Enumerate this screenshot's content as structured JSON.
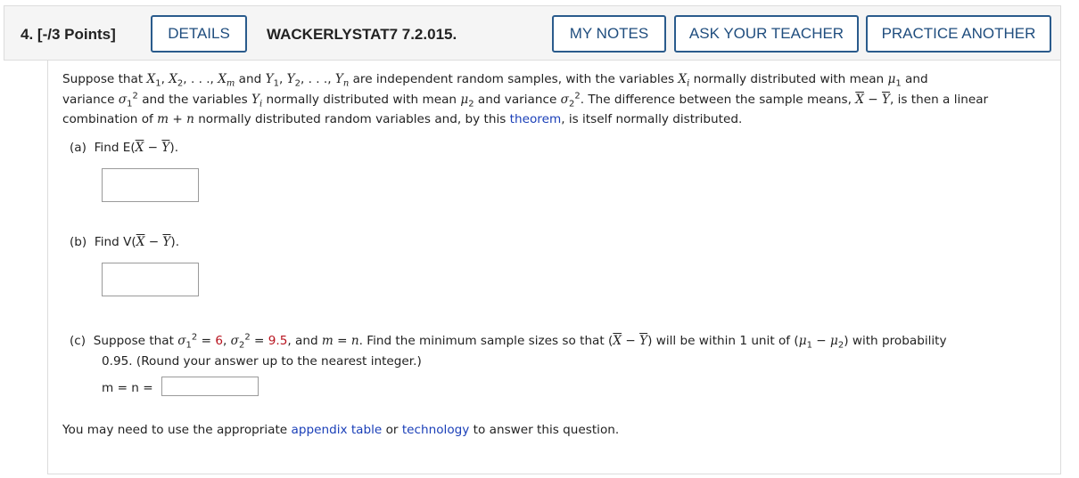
{
  "header": {
    "question_number": "4.",
    "points": "[-/3 Points]",
    "details_label": "DETAILS",
    "assignment_code": "WACKERLYSTAT7 7.2.015.",
    "my_notes_label": "MY NOTES",
    "ask_teacher_label": "ASK YOUR TEACHER",
    "practice_another_label": "PRACTICE ANOTHER"
  },
  "intro": {
    "t1": "Suppose that ",
    "t2": " are independent random samples, with the variables ",
    "t3": " normally distributed with mean ",
    "t4": " and",
    "t5": "variance ",
    "t6": " and the variables ",
    "t7": " normally distributed with mean ",
    "t8": " and variance ",
    "t9": ". The difference between the sample means, ",
    "t10": ", is then a linear",
    "t11": "combination of ",
    "t12": " normally distributed random variables and, by this ",
    "theorem_link": "theorem",
    "t13": ", is itself normally distributed."
  },
  "part_a": {
    "label": "(a)",
    "prompt": "Find E(",
    "close": ").",
    "answer": ""
  },
  "part_b": {
    "label": "(b)",
    "prompt": "Find V(",
    "close": ").",
    "answer": ""
  },
  "part_c": {
    "label": "(c)",
    "t1": "Suppose that ",
    "sigma1_value": "6",
    "sigma2_value": "9.5",
    "t2": ", and ",
    "t3": ". Find the minimum sample sizes so that ",
    "t4": " will be within 1 unit of ",
    "t5": " with probability",
    "line2": "0.95. (Round your answer up to the nearest integer.)",
    "answer_label": "m = n =",
    "answer": ""
  },
  "footer": {
    "t1": "You may need to use the appropriate ",
    "appendix_link": "appendix table",
    "t2": " or ",
    "technology_link": "technology",
    "t3": " to answer this question."
  },
  "colors": {
    "button_border": "#2a5b8c",
    "link": "#1a3fb8",
    "number_highlight": "#b8141f"
  }
}
